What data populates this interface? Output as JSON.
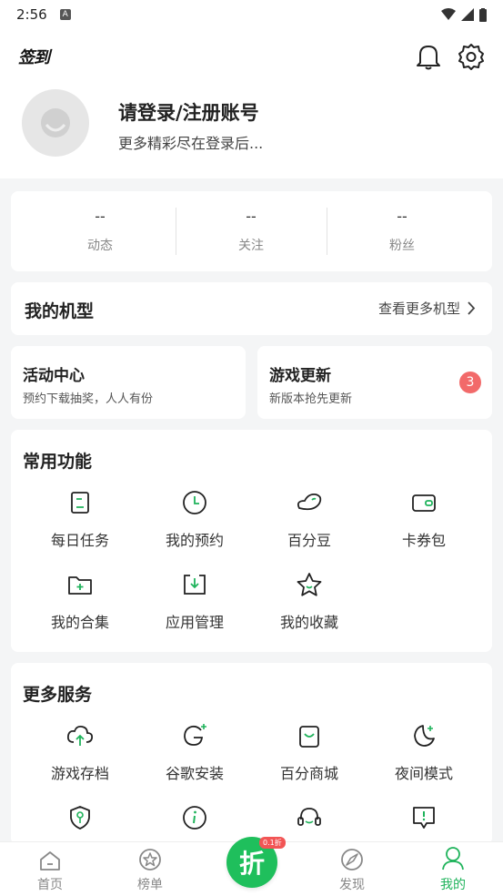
{
  "status_bar": {
    "time": "2:56"
  },
  "header": {
    "sign_label": "签到"
  },
  "profile": {
    "title": "请登录/注册账号",
    "subtitle": "更多精彩尽在登录后..."
  },
  "stats": [
    {
      "value": "--",
      "label": "动态"
    },
    {
      "value": "--",
      "label": "关注"
    },
    {
      "value": "--",
      "label": "粉丝"
    }
  ],
  "my_device": {
    "title": "我的机型",
    "link": "查看更多机型"
  },
  "activity": {
    "title": "活动中心",
    "subtitle": "预约下载抽奖，人人有份"
  },
  "game_update": {
    "title": "游戏更新",
    "subtitle": "新版本抢先更新",
    "badge": "3"
  },
  "common": {
    "title": "常用功能",
    "items": [
      {
        "label": "每日任务",
        "icon": "task-icon"
      },
      {
        "label": "我的预约",
        "icon": "clock-icon"
      },
      {
        "label": "百分豆",
        "icon": "bean-icon"
      },
      {
        "label": "卡券包",
        "icon": "wallet-icon"
      },
      {
        "label": "我的合集",
        "icon": "folder-plus-icon"
      },
      {
        "label": "应用管理",
        "icon": "download-box-icon"
      },
      {
        "label": "我的收藏",
        "icon": "star-icon"
      }
    ]
  },
  "more": {
    "title": "更多服务",
    "items": [
      {
        "label": "游戏存档",
        "icon": "cloud-upload-icon"
      },
      {
        "label": "谷歌安装",
        "icon": "google-icon"
      },
      {
        "label": "百分商城",
        "icon": "shop-bag-icon"
      },
      {
        "label": "夜间模式",
        "icon": "moon-icon"
      }
    ]
  },
  "tabbar": {
    "items": [
      {
        "label": "首页",
        "icon": "home-icon"
      },
      {
        "label": "榜单",
        "icon": "star-circle-icon"
      },
      {
        "label": "发现",
        "icon": "compass-icon"
      },
      {
        "label": "我的",
        "icon": "person-icon"
      }
    ],
    "center_label": "折",
    "center_tag": "0.1折"
  },
  "colors": {
    "accent": "#1fb35b",
    "badge": "#f26a6a"
  }
}
